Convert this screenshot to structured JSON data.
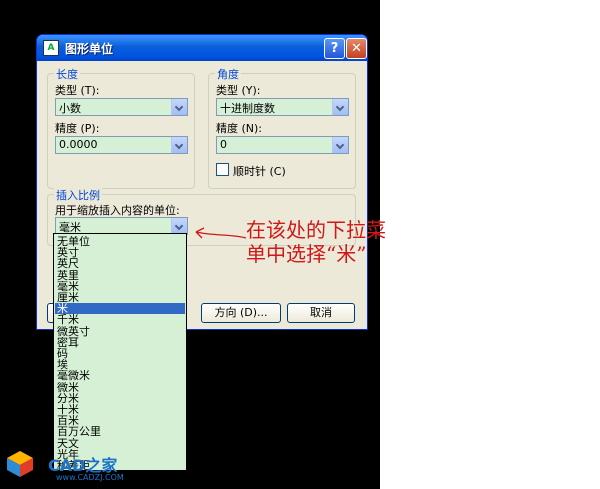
{
  "dialog": {
    "title": "图形单位",
    "help_label": "?",
    "close_label": "✕"
  },
  "length": {
    "legend": "长度",
    "type_label": "类型 (T):",
    "type_value": "小数",
    "precision_label": "精度 (P):",
    "precision_value": "0.0000"
  },
  "angle": {
    "legend": "角度",
    "type_label": "类型 (Y):",
    "type_value": "十进制度数",
    "precision_label": "精度 (N):",
    "precision_value": "0",
    "clockwise_label": "顺时针 (C)",
    "clockwise_checked": false
  },
  "insert_scale": {
    "legend": "插入比例",
    "label": "用于缩放插入内容的单位:",
    "current_value": "毫米",
    "options": [
      "无单位",
      "英寸",
      "英尺",
      "英里",
      "毫米",
      "厘米",
      "米",
      "千米",
      "微英寸",
      "密耳",
      "码",
      "埃",
      "毫微米",
      "微米",
      "分米",
      "十米",
      "百米",
      "百万公里",
      "天文",
      "光年",
      "秒差距"
    ],
    "selected_index": 6
  },
  "buttons": {
    "direction": "方向 (D)...",
    "cancel": "取消"
  },
  "annotation": {
    "line1": "在该处的下拉菜",
    "line2": "单中选择“米”",
    "color": "#d01818"
  },
  "logo": {
    "name": "CAD之家",
    "url": "www.CADZJ.COM"
  },
  "icons": {
    "app": "autocad-app-icon",
    "help": "help-icon",
    "close": "close-icon",
    "drop": "chevron-down-icon"
  }
}
